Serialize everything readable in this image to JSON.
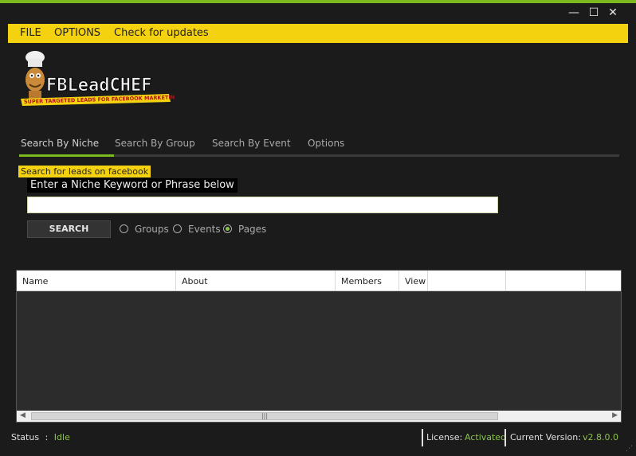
{
  "window": {
    "minimize": "—",
    "maximize": "☐",
    "close": "✕"
  },
  "menu": {
    "file": "FILE",
    "options": "OPTIONS",
    "updates": "Check for updates"
  },
  "logo": {
    "title": "FBLeadCHEF",
    "tagline": "SUPER TARGETED LEADS FOR FACEBOOK MARKETING"
  },
  "tabs": [
    {
      "label": "Search By Niche",
      "active": true
    },
    {
      "label": "Search By Group",
      "active": false
    },
    {
      "label": "Search By Event",
      "active": false
    },
    {
      "label": "Options",
      "active": false
    }
  ],
  "search": {
    "section_label": "Search for leads on facebook",
    "prompt": "Enter a Niche Keyword or Phrase below",
    "value": "",
    "button": "SEARCH",
    "options": [
      {
        "label": "Groups",
        "checked": false
      },
      {
        "label": "Events",
        "checked": false
      },
      {
        "label": "Pages",
        "checked": true
      }
    ]
  },
  "grid": {
    "columns": [
      "Name",
      "About",
      "Members",
      "View",
      "",
      ""
    ]
  },
  "status": {
    "label": "Status",
    "separator": ":",
    "value": "Idle",
    "license_label": "License:",
    "license_value": "Activated",
    "version_label": "Current Version:",
    "version_value": "v2.8.0.0"
  },
  "colors": {
    "accent_green": "#7cba1f",
    "menu_yellow": "#f5d20f",
    "background": "#1b1b1b"
  }
}
